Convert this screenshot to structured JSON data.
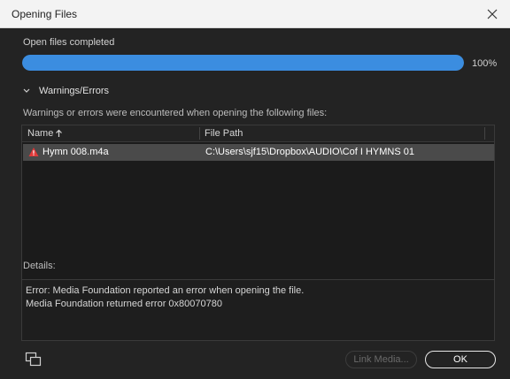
{
  "window": {
    "title": "Opening Files"
  },
  "progress": {
    "status": "Open files completed",
    "percent_label": "100%",
    "fraction": 1.0,
    "fill_color": "#3b8de0"
  },
  "warnings": {
    "section_label": "Warnings/Errors",
    "description": "Warnings or errors were encountered when opening the following files:",
    "columns": {
      "name": "Name",
      "path": "File Path"
    },
    "rows": [
      {
        "name": "Hymn 008.m4a",
        "path": "C:\\Users\\sjf15\\Dropbox\\AUDIO\\Cof I HYMNS 01",
        "icon": "warning-icon"
      }
    ]
  },
  "details": {
    "label": "Details:",
    "lines": [
      "Error: Media Foundation reported an error when opening the file.",
      "Media Foundation returned error 0x80070780"
    ]
  },
  "buttons": {
    "link_media": "Link Media...",
    "ok": "OK"
  },
  "colors": {
    "warning": "#e03a3a",
    "accent": "#3b8de0"
  }
}
